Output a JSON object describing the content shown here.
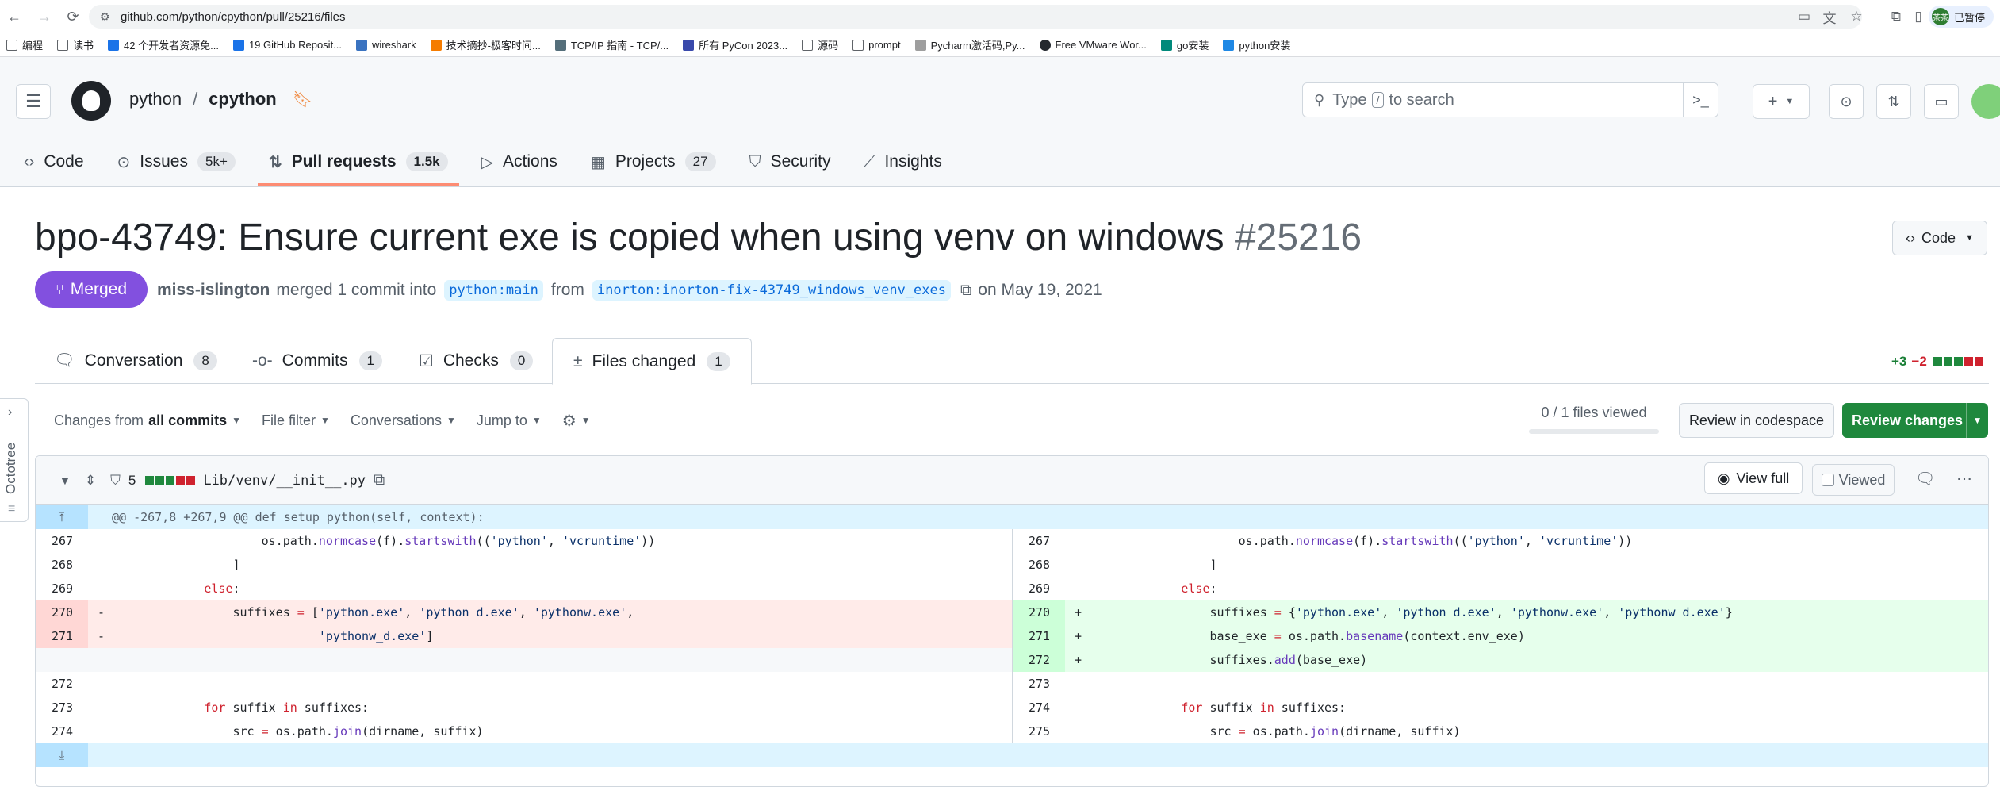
{
  "browser": {
    "url": "github.com/python/cpython/pull/25216/files",
    "profile_label": "已暂停",
    "profile_avatar": "茶茶",
    "bookmarks": [
      {
        "label": "编程",
        "icon": "folder-icon",
        "color": "#5f6368"
      },
      {
        "label": "读书",
        "icon": "folder-icon",
        "color": "#5f6368"
      },
      {
        "label": "42 个开发者资源免...",
        "icon": "site-icon",
        "color": "#1a73e8"
      },
      {
        "label": "19 GitHub Reposit...",
        "icon": "site-icon",
        "color": "#1a73e8"
      },
      {
        "label": "wireshark",
        "icon": "site-icon",
        "color": "#3a73c0"
      },
      {
        "label": "技术摘抄-极客时间...",
        "icon": "site-icon",
        "color": "#f57c00"
      },
      {
        "label": "TCP/IP 指南 - TCP/...",
        "icon": "site-icon",
        "color": "#546e7a"
      },
      {
        "label": "所有 PyCon 2023...",
        "icon": "site-icon",
        "color": "#3949ab"
      },
      {
        "label": "源码",
        "icon": "folder-icon",
        "color": "#5f6368"
      },
      {
        "label": "prompt",
        "icon": "folder-icon",
        "color": "#5f6368"
      },
      {
        "label": "Pycharm激活码,Py...",
        "icon": "site-icon",
        "color": "#9e9e9e"
      },
      {
        "label": "Free VMware Wor...",
        "icon": "github-icon",
        "color": "#24292f"
      },
      {
        "label": "go安装",
        "icon": "site-icon",
        "color": "#00897b"
      },
      {
        "label": "python安装",
        "icon": "site-icon",
        "color": "#1e88e5"
      }
    ]
  },
  "repo": {
    "owner": "python",
    "separator": "/",
    "name": "cpython",
    "search_placeholder_pre": "Type",
    "search_key": "/",
    "search_placeholder_post": "to search"
  },
  "repo_nav": [
    {
      "label": "Code",
      "icon": "code-icon",
      "count": ""
    },
    {
      "label": "Issues",
      "icon": "issue-icon",
      "count": "5k+"
    },
    {
      "label": "Pull requests",
      "icon": "pull-request-icon",
      "count": "1.5k"
    },
    {
      "label": "Actions",
      "icon": "play-icon",
      "count": ""
    },
    {
      "label": "Projects",
      "icon": "table-icon",
      "count": "27"
    },
    {
      "label": "Security",
      "icon": "shield-icon",
      "count": ""
    },
    {
      "label": "Insights",
      "icon": "graph-icon",
      "count": ""
    }
  ],
  "pr": {
    "title": "bpo-43749: Ensure current exe is copied when using venv on windows",
    "number": "#25216",
    "status": "Merged",
    "author": "miss-islington",
    "merged_text": "merged 1 commit into",
    "base_branch": "python:main",
    "from_text": "from",
    "head_branch": "inorton:inorton-fix-43749_windows_venv_exes",
    "date_text": "on May 19, 2021",
    "code_button": "Code"
  },
  "pr_tabs": [
    {
      "label": "Conversation",
      "count": "8"
    },
    {
      "label": "Commits",
      "count": "1"
    },
    {
      "label": "Checks",
      "count": "0"
    },
    {
      "label": "Files changed",
      "count": "1"
    }
  ],
  "diffstat": {
    "additions": "+3",
    "deletions": "−2"
  },
  "toolbar": {
    "changes_from": "Changes from",
    "all_commits": "all commits",
    "file_filter": "File filter",
    "conversations": "Conversations",
    "jump_to": "Jump to",
    "files_viewed": "0 / 1 files viewed",
    "review_codespace": "Review in codespace",
    "review_changes": "Review changes"
  },
  "octotree": {
    "label": "Octotree"
  },
  "file": {
    "change_count": "5",
    "path": "Lib/venv/__init__.py",
    "view_full": "View full",
    "viewed": "Viewed",
    "hunk": "@@ -267,8 +267,9 @@ def setup_python(self, context):",
    "left": [
      {
        "num": "267",
        "mark": "",
        "code": "                    os.path.normcase(f).startswith(('python', 'vcruntime'))",
        "type": "ctx"
      },
      {
        "num": "268",
        "mark": "",
        "code": "                ]",
        "type": "ctx"
      },
      {
        "num": "269",
        "mark": "",
        "code": "            else:",
        "type": "ctx"
      },
      {
        "num": "270",
        "mark": "-",
        "code": "                suffixes = ['python.exe', 'python_d.exe', 'pythonw.exe',",
        "type": "del"
      },
      {
        "num": "271",
        "mark": "-",
        "code": "                            'pythonw_d.exe']",
        "type": "del"
      },
      {
        "num": "",
        "mark": "",
        "code": "",
        "type": "empty"
      },
      {
        "num": "272",
        "mark": "",
        "code": "",
        "type": "ctx"
      },
      {
        "num": "273",
        "mark": "",
        "code": "            for suffix in suffixes:",
        "type": "ctx"
      },
      {
        "num": "274",
        "mark": "",
        "code": "                src = os.path.join(dirname, suffix)",
        "type": "ctx"
      }
    ],
    "right": [
      {
        "num": "267",
        "mark": "",
        "code": "                    os.path.normcase(f).startswith(('python', 'vcruntime'))",
        "type": "ctx"
      },
      {
        "num": "268",
        "mark": "",
        "code": "                ]",
        "type": "ctx"
      },
      {
        "num": "269",
        "mark": "",
        "code": "            else:",
        "type": "ctx"
      },
      {
        "num": "270",
        "mark": "+",
        "code": "                suffixes = {'python.exe', 'python_d.exe', 'pythonw.exe', 'pythonw_d.exe'}",
        "type": "add"
      },
      {
        "num": "271",
        "mark": "+",
        "code": "                base_exe = os.path.basename(context.env_exe)",
        "type": "add"
      },
      {
        "num": "272",
        "mark": "+",
        "code": "                suffixes.add(base_exe)",
        "type": "add"
      },
      {
        "num": "273",
        "mark": "",
        "code": "",
        "type": "ctx"
      },
      {
        "num": "274",
        "mark": "",
        "code": "            for suffix in suffixes:",
        "type": "ctx"
      },
      {
        "num": "275",
        "mark": "",
        "code": "                src = os.path.join(dirname, suffix)",
        "type": "ctx"
      }
    ]
  },
  "colors": {
    "merged": "#8250df",
    "accent_tab": "#fd8c73",
    "review_green": "#1f883d",
    "add": "#1a7f37",
    "del": "#cf222e"
  }
}
